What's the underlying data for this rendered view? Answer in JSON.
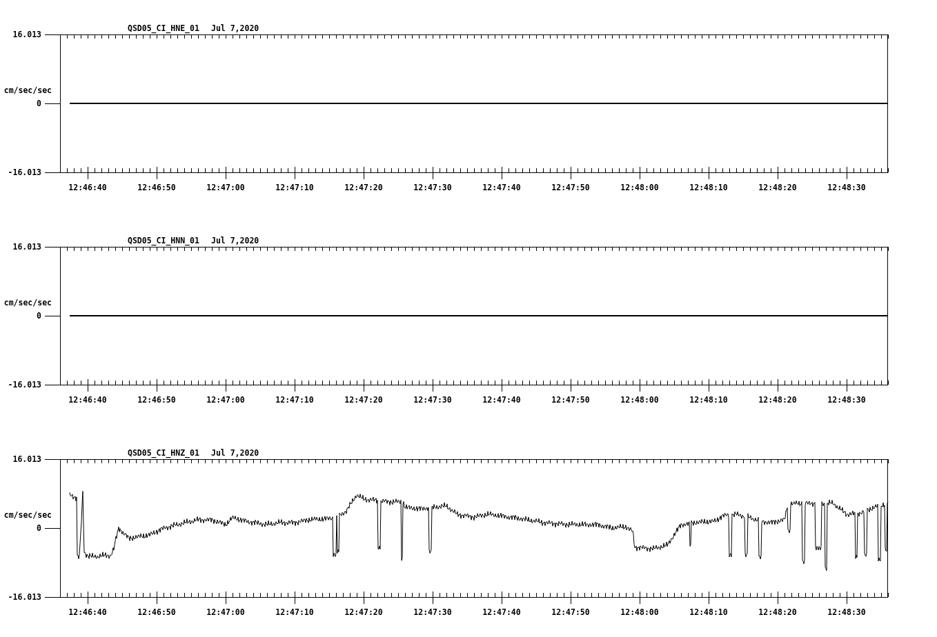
{
  "plots": [
    {
      "channel": "QSD05_CI_HNE_01",
      "date": "Jul 7,2020",
      "ylabel": "cm/sec/sec",
      "yticks": [
        "16.013",
        "0",
        "-16.013"
      ],
      "xticks": [
        "12:46:40",
        "12:46:50",
        "12:47:00",
        "12:47:10",
        "12:47:20",
        "12:47:30",
        "12:47:40",
        "12:47:50",
        "12:48:00",
        "12:48:10",
        "12:48:20",
        "12:48:30"
      ],
      "kind": "flat"
    },
    {
      "channel": "QSD05_CI_HNN_01",
      "date": "Jul 7,2020",
      "ylabel": "cm/sec/sec",
      "yticks": [
        "16.013",
        "0",
        "-16.013"
      ],
      "xticks": [
        "12:46:40",
        "12:46:50",
        "12:47:00",
        "12:47:10",
        "12:47:20",
        "12:47:30",
        "12:47:40",
        "12:47:50",
        "12:48:00",
        "12:48:10",
        "12:48:20",
        "12:48:30"
      ],
      "kind": "flat"
    },
    {
      "channel": "QSD05_CI_HNZ_01",
      "date": "Jul 7,2020",
      "ylabel": "cm/sec/sec",
      "yticks": [
        "16.013",
        "0",
        "-16.013"
      ],
      "xticks": [
        "12:46:40",
        "12:46:50",
        "12:47:00",
        "12:47:10",
        "12:47:20",
        "12:47:30",
        "12:47:40",
        "12:47:50",
        "12:48:00",
        "12:48:10",
        "12:48:20",
        "12:48:30"
      ],
      "kind": "waveform"
    }
  ]
}
